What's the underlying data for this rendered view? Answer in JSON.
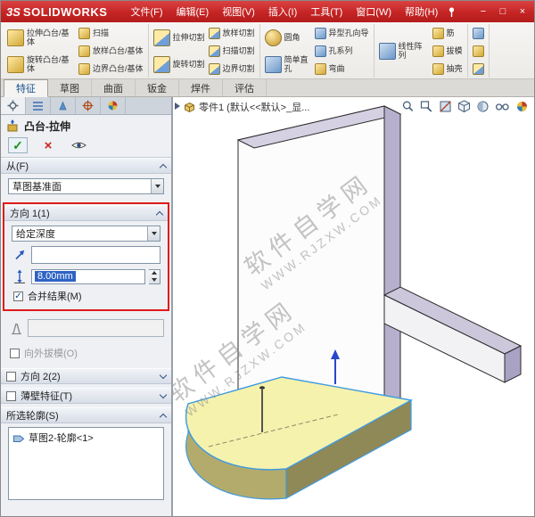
{
  "menu_bar": {
    "logo_mark": "3S",
    "logo_text": "SOLIDWORKS",
    "menus": [
      "文件(F)",
      "编辑(E)",
      "视图(V)",
      "插入(I)",
      "工具(T)",
      "窗口(W)",
      "帮助(H)"
    ],
    "window_controls": [
      "−",
      "□",
      "×"
    ]
  },
  "ribbon": {
    "groups": [
      {
        "big": [
          "拉伸凸台/基体",
          "旋转凸台/基体"
        ],
        "small": [
          "扫描",
          "放样凸台/基体",
          "边界凸台/基体"
        ]
      },
      {
        "big": [
          "拉伸切割",
          "旋转切割"
        ],
        "small": [
          "放样切割",
          "扫描切割",
          "边界切割"
        ]
      },
      {
        "big": [
          "圆角",
          "简单直孔"
        ],
        "small": [
          "异型孔向导",
          "孔系列",
          "弯曲"
        ]
      },
      {
        "big": [
          "线性阵列"
        ],
        "small": [
          "筋",
          "拔模",
          "抽壳"
        ]
      }
    ]
  },
  "tabs": {
    "active": "特征",
    "items": [
      "特征",
      "草图",
      "曲面",
      "钣金",
      "焊件",
      "评估"
    ]
  },
  "property_panel": {
    "title": "凸台-拉伸",
    "from": {
      "header": "从(F)",
      "plane": "草图基准面"
    },
    "direction1": {
      "header": "方向 1(1)",
      "end_condition": "给定深度",
      "depth_value": "8.00mm",
      "merge_label": "合并结果(M)"
    },
    "draft": {
      "outward_label": "向外拔模(O)"
    },
    "direction2": {
      "header": "方向 2(2)"
    },
    "thin_feature": {
      "header": "薄壁特征(T)"
    },
    "selected_contours": {
      "header": "所选轮廓(S)",
      "items": [
        "草图2-轮廓<1>"
      ]
    }
  },
  "graphics": {
    "doc_title": "零件1 (默认<<默认>_显...",
    "watermark": {
      "line1": "软件自学网",
      "line2": "WWW.RJZXW.COM"
    },
    "colors": {
      "wall_front": "#fcfcfd",
      "wall_top": "#d6d0e3",
      "wall_side": "#b7b0cd",
      "flange_top": "#cdc7dc",
      "flange_front": "#f2f2f5",
      "flange_side": "#aaa2c2",
      "preview_top": "#f5f2ad",
      "preview_front": "#8f8857",
      "preview_curve": "#b3ab6c",
      "edge_blue": "#3f9be0",
      "arrow_blue": "#2746c9",
      "accent_red": "#e01b1b"
    }
  },
  "icons": {
    "check": "✓",
    "close": "×"
  }
}
